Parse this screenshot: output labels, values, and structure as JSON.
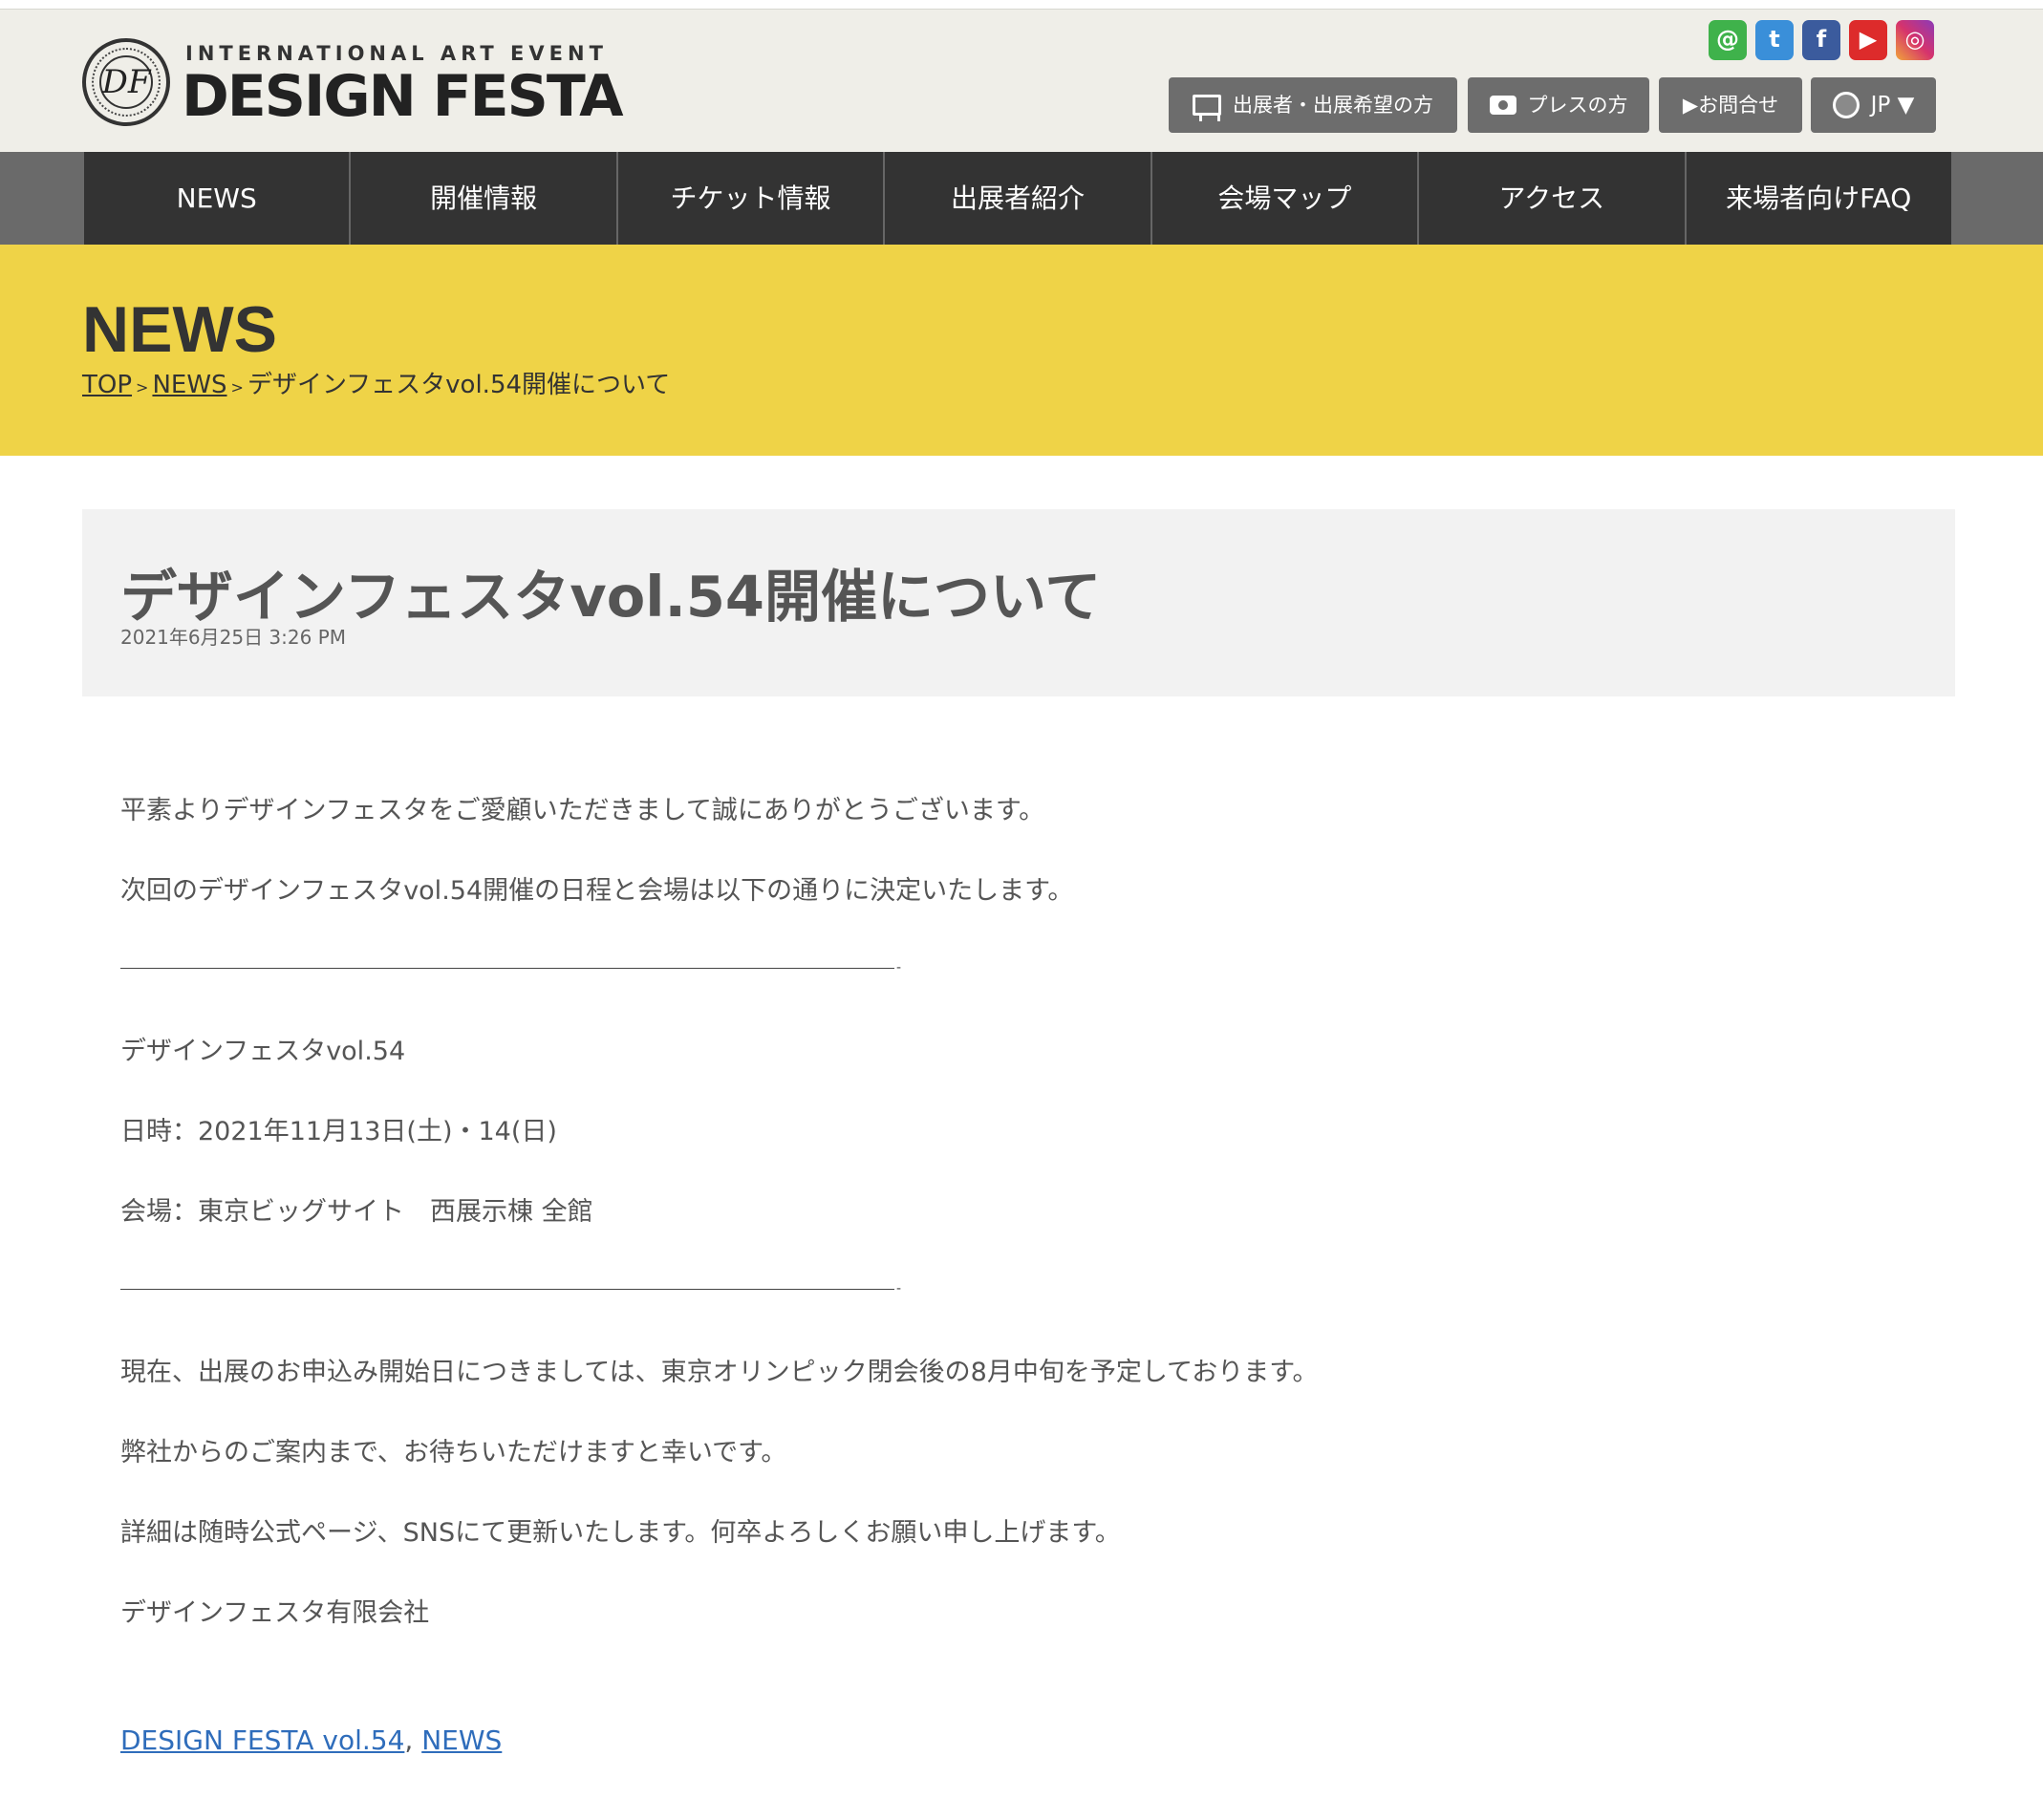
{
  "header": {
    "logo_monogram": "DF",
    "logo_subtitle": "INTERNATIONAL ART EVENT",
    "logo_title": "DESIGN FESTA",
    "social": {
      "mail_glyph": "@",
      "twitter_glyph": "t",
      "facebook_glyph": "f",
      "youtube_glyph": "▶",
      "instagram_glyph": "◎"
    },
    "buttons": {
      "exhibitor": "出展者・出展希望の方",
      "press": "プレスの方",
      "contact": "▶お問合せ",
      "language": "JP ▼"
    }
  },
  "nav": {
    "items": [
      "NEWS",
      "開催情報",
      "チケット情報",
      "出展者紹介",
      "会場マップ",
      "アクセス",
      "来場者向けFAQ"
    ]
  },
  "hero": {
    "title": "NEWS",
    "breadcrumb": {
      "top": "TOP",
      "news": "NEWS",
      "separator": ">",
      "current": "デザインフェスタvol.54開催について"
    }
  },
  "article": {
    "title": "デザインフェスタvol.54開催について",
    "date": "2021年6月25日 3:26 PM",
    "paragraphs": [
      "平素よりデザインフェスタをご愛顧いただきまして誠にありがとうございます。",
      "次回のデザインフェスタvol.54開催の日程と会場は以下の通りに決定いたします。",
      "デザインフェスタvol.54",
      "日時：2021年11月13日(土)・14(日)",
      "会場：東京ビッグサイト　西展示棟 全館",
      "現在、出展のお申込み開始日につきましては、東京オリンピック閉会後の8月中旬を予定しております。",
      "弊社からのご案内まで、お待ちいただけますと幸いです。",
      "詳細は随時公式ページ、SNSにて更新いたします。何卒よろしくお願い申し上げます。",
      "デザインフェスタ有限会社"
    ],
    "divider_tail": "-",
    "tags": [
      "DESIGN FESTA vol.54",
      "NEWS"
    ],
    "tag_separator": ", "
  },
  "colors": {
    "header_bg": "#efeee8",
    "nav_bg": "#333333",
    "hero_bg": "#efd347",
    "link": "#2f6dbb"
  }
}
